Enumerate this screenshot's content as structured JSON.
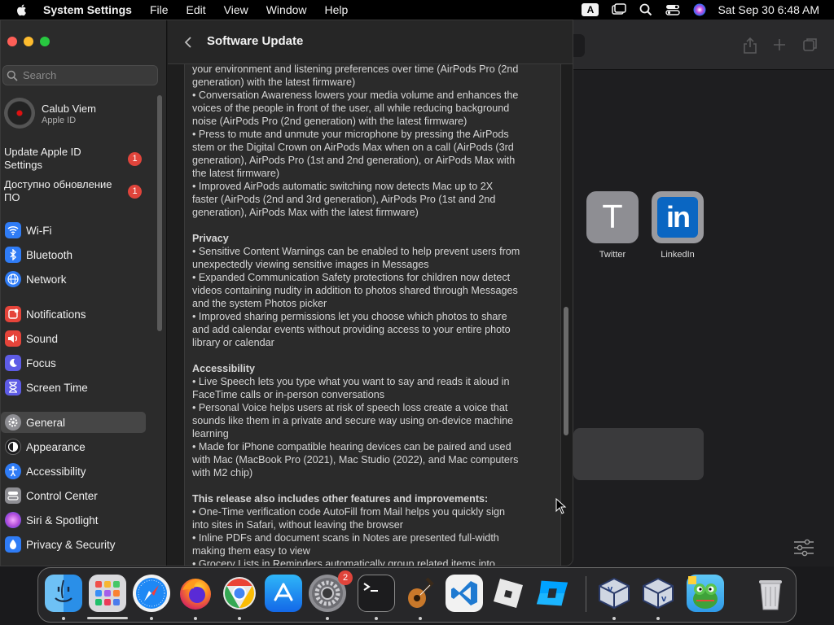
{
  "menubar": {
    "app_name": "System Settings",
    "menus": [
      "File",
      "Edit",
      "View",
      "Window",
      "Help"
    ],
    "input_source": "A",
    "clock": "Sat Sep 30  6:48 AM"
  },
  "browser": {
    "tiles": [
      {
        "letter": "T",
        "label": "Twitter"
      },
      {
        "letter": "in",
        "label": "LinkedIn"
      }
    ]
  },
  "sidebar": {
    "search_placeholder": "Search",
    "profile": {
      "name": "Calub Viem",
      "subtitle": "Apple ID"
    },
    "notices": [
      {
        "label": "Update Apple ID Settings",
        "badge": "1"
      },
      {
        "label": "Доступно обновление ПО",
        "badge": "1"
      }
    ],
    "groups": [
      [
        {
          "label": "Wi-Fi",
          "icon": "wifi-icon",
          "color": "#2f7cf6"
        },
        {
          "label": "Bluetooth",
          "icon": "bluetooth-icon",
          "color": "#2f7cf6"
        },
        {
          "label": "Network",
          "icon": "network-icon",
          "color": "#2f7cf6"
        }
      ],
      [
        {
          "label": "Notifications",
          "icon": "notifications-icon",
          "color": "#e5443a"
        },
        {
          "label": "Sound",
          "icon": "sound-icon",
          "color": "#e5443a"
        },
        {
          "label": "Focus",
          "icon": "focus-icon",
          "color": "#5e5ce6"
        },
        {
          "label": "Screen Time",
          "icon": "screen-time-icon",
          "color": "#5e5ce6"
        }
      ],
      [
        {
          "label": "General",
          "icon": "general-icon",
          "color": "#8e8e93",
          "selected": true
        },
        {
          "label": "Appearance",
          "icon": "appearance-icon",
          "color": "#1c1c1e"
        },
        {
          "label": "Accessibility",
          "icon": "accessibility-icon",
          "color": "#2f7cf6"
        },
        {
          "label": "Control Center",
          "icon": "control-center-icon",
          "color": "#8e8e93"
        },
        {
          "label": "Siri & Spotlight",
          "icon": "siri-icon",
          "color": "#b04ad8"
        },
        {
          "label": "Privacy & Security",
          "icon": "privacy-icon",
          "color": "#2f7cf6"
        }
      ]
    ]
  },
  "main": {
    "title": "Software Update",
    "notes_lines": [
      {
        "t": "your environment and listening preferences over time (AirPods Pro (2nd"
      },
      {
        "t": "generation) with the latest firmware)"
      },
      {
        "t": "• Conversation Awareness lowers your media volume and enhances the"
      },
      {
        "t": "voices of the people in front of the user, all while reducing background"
      },
      {
        "t": "noise (AirPods Pro (2nd generation) with the latest firmware)"
      },
      {
        "t": "• Press to mute and unmute your microphone by pressing the AirPods"
      },
      {
        "t": "stem or the Digital Crown on AirPods Max when on a call (AirPods (3rd"
      },
      {
        "t": "generation), AirPods Pro (1st and 2nd generation), or AirPods Max with"
      },
      {
        "t": "the latest firmware)"
      },
      {
        "t": "• Improved AirPods automatic switching now detects Mac up to 2X"
      },
      {
        "t": "faster (AirPods (2nd and 3rd generation), AirPods Pro (1st and 2nd"
      },
      {
        "t": "generation), AirPods Max with the latest firmware)"
      },
      {
        "t": ""
      },
      {
        "t": "Privacy",
        "h": true
      },
      {
        "t": "• Sensitive Content Warnings can be enabled to help prevent users from"
      },
      {
        "t": "unexpectedly viewing sensitive images in Messages"
      },
      {
        "t": "• Expanded Communication Safety protections for children now detect"
      },
      {
        "t": "videos containing nudity in addition to photos shared through Messages"
      },
      {
        "t": "and the system Photos picker"
      },
      {
        "t": "• Improved sharing permissions let you choose which photos to share"
      },
      {
        "t": "and add calendar events without providing access to your entire photo"
      },
      {
        "t": "library or calendar"
      },
      {
        "t": ""
      },
      {
        "t": "Accessibility",
        "h": true
      },
      {
        "t": "• Live Speech lets you type what you want to say and reads it aloud in"
      },
      {
        "t": "FaceTime calls or in-person conversations"
      },
      {
        "t": "• Personal Voice helps users at risk of speech loss create a voice that"
      },
      {
        "t": "sounds like them in a private and secure way using on-device machine"
      },
      {
        "t": "learning"
      },
      {
        "t": "• Made for iPhone compatible hearing devices can be paired and used"
      },
      {
        "t": "with Mac (MacBook Pro (2021), Mac Studio (2022), and Mac computers"
      },
      {
        "t": "with M2 chip)"
      },
      {
        "t": ""
      },
      {
        "t": "This release also includes other features and improvements:",
        "h": true
      },
      {
        "t": "• One-Time verification code AutoFill from Mail helps you quickly sign"
      },
      {
        "t": "into sites in Safari, without leaving the browser"
      },
      {
        "t": "• Inline PDFs and document scans in Notes are presented full-width"
      },
      {
        "t": "making them easy to view"
      },
      {
        "t": "• Grocery Lists in Reminders automatically group related items into"
      }
    ]
  },
  "dock": {
    "settings_badge": "2",
    "apps": [
      "finder-icon",
      "launchpad-icon",
      "safari-icon",
      "firefox-icon",
      "chrome-icon",
      "app-store-icon",
      "system-settings-icon",
      "terminal-icon",
      "garageband-icon",
      "vscode-icon",
      "roblox-icon",
      "roblox-studio-icon",
      "virtualbox-icon",
      "virtualbox-vm-icon",
      "game-icon",
      "trash-icon"
    ]
  }
}
